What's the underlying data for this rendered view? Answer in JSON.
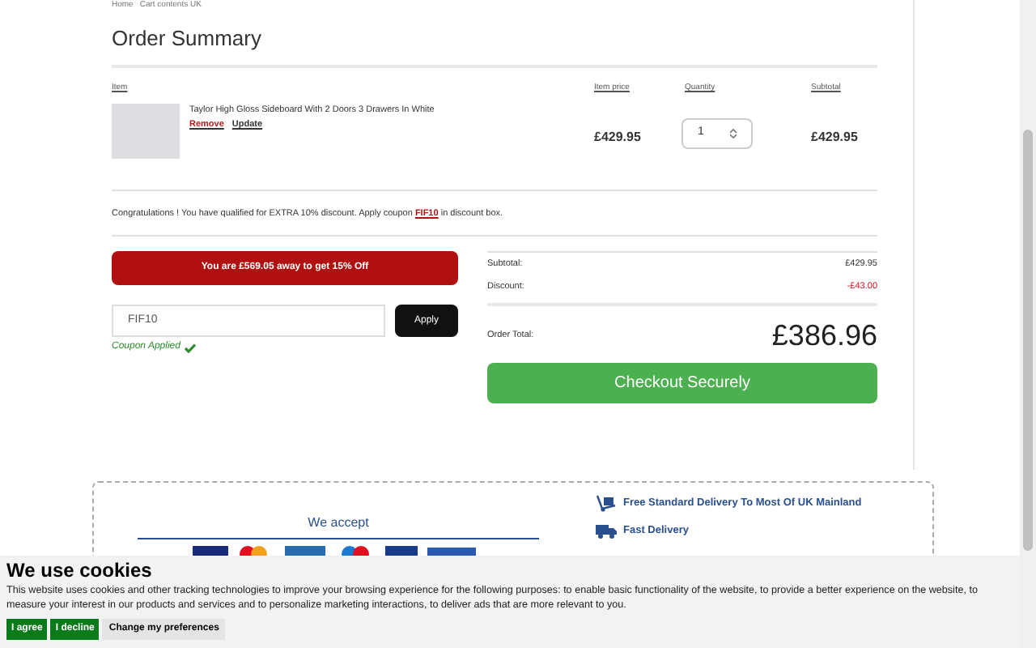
{
  "breadcrumb": [
    "Home",
    "Cart contents UK"
  ],
  "title": "Order Summary",
  "columns": [
    "Item",
    "Item price",
    "Quantity",
    "Subtotal"
  ],
  "items": [
    {
      "name": "Taylor High Gloss Sideboard With 2 Doors 3 Drawers In White",
      "remove": "Remove",
      "update": "Update",
      "price": "£429.95",
      "quantity": "1",
      "subtotal": "£429.95"
    }
  ],
  "notice": "Congratulations ! You have qualified for EXTRA 10% discount. Apply coupon **FIF10** in discount box.",
  "promo_banner": "You are £569.05 away to get 15% Off",
  "coupon": {
    "value": "FIF10",
    "button": "Apply",
    "status": "Coupon Applied",
    "applied": true
  },
  "totals": [
    {
      "label": "Subtotal:",
      "value": "£429.95",
      "kind": "plain"
    },
    {
      "label": "Discount:",
      "value": "-£43.00",
      "kind": "discount"
    }
  ],
  "order_total": {
    "label": "Order Total:",
    "value": "£386.96"
  },
  "checkout_button": "Checkout Securely",
  "footer": {
    "accept_title": "We accept",
    "features": [
      "Free Standard Delivery To Most Of UK Mainland",
      "Fast Delivery"
    ]
  },
  "cookie_banner": {
    "title": "We use cookies",
    "text": "This website uses cookies and other tracking technologies to improve your browsing experience for the following purposes: to enable basic functionality of the website, to provide a better experience on the website, to measure your interest in our products and services and to personalize marketing interactions, to deliver ads that are more relevant to you.",
    "buttons": [
      {
        "label": "I agree",
        "kind": "primary"
      },
      {
        "label": "I decline",
        "kind": "primary"
      },
      {
        "label": "Change my preferences",
        "kind": "secondary"
      }
    ]
  }
}
